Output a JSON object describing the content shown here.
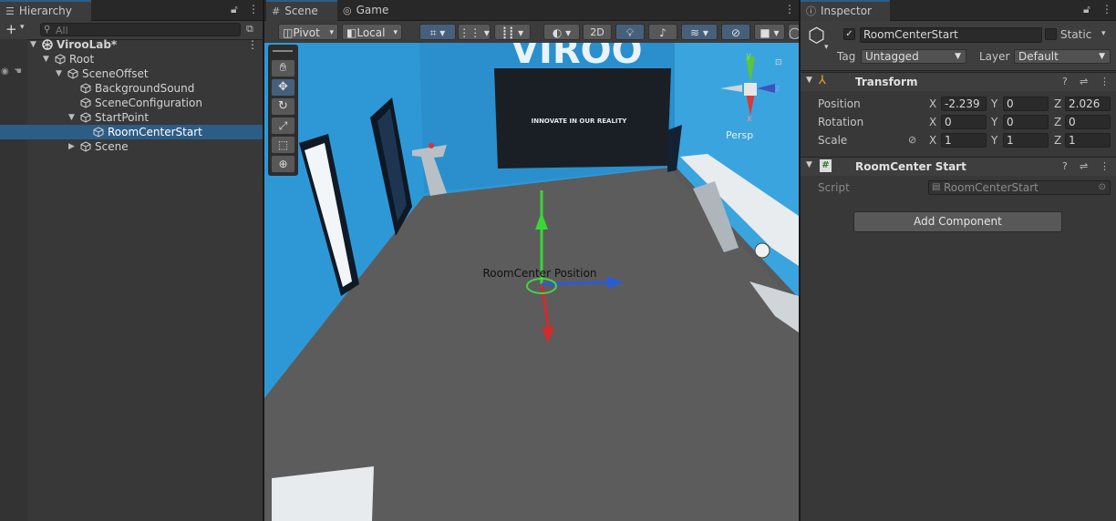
{
  "hierarchy": {
    "tab_title": "Hierarchy",
    "search_placeholder": "All",
    "rows": [
      {
        "label": "VirooLab*",
        "depth": 0,
        "expanded": true,
        "kind": "scene"
      },
      {
        "label": "Root",
        "depth": 1,
        "expanded": true,
        "kind": "object"
      },
      {
        "label": "SceneOffset",
        "depth": 2,
        "expanded": true,
        "kind": "object"
      },
      {
        "label": "BackgroundSound",
        "depth": 3,
        "expanded": null,
        "kind": "object"
      },
      {
        "label": "SceneConfiguration",
        "depth": 3,
        "expanded": null,
        "kind": "object"
      },
      {
        "label": "StartPoint",
        "depth": 3,
        "expanded": true,
        "kind": "object"
      },
      {
        "label": "RoomCenterStart",
        "depth": 4,
        "expanded": null,
        "kind": "object",
        "selected": true
      },
      {
        "label": "Scene",
        "depth": 3,
        "expanded": false,
        "kind": "object"
      }
    ]
  },
  "scene_view": {
    "tabs": [
      {
        "label": "Scene",
        "icon": "grid-icon",
        "active": true
      },
      {
        "label": "Game",
        "icon": "gamepad-icon",
        "active": false
      }
    ],
    "toolbar": {
      "pivot_label": "Pivot",
      "local_label": "Local",
      "mode_2d_label": "2D"
    },
    "tools": [
      "hand-tool",
      "move-tool",
      "rotate-tool",
      "scale-tool",
      "rect-tool",
      "transform-tool"
    ],
    "wall_sign": "VIROO",
    "screen_text": "INNOVATE IN OUR REALITY",
    "gizmo_label": "RoomCenter Position",
    "orientation": {
      "persp_label": "Persp",
      "x": "x",
      "y": "y",
      "z": "z"
    }
  },
  "inspector": {
    "tab_title": "Inspector",
    "object_name": "RoomCenterStart",
    "active": true,
    "static_label": "Static",
    "tag_label": "Tag",
    "tag_value": "Untagged",
    "layer_label": "Layer",
    "layer_value": "Default",
    "transform": {
      "title": "Transform",
      "position_label": "Position",
      "rotation_label": "Rotation",
      "scale_label": "Scale",
      "position": {
        "x": "-2.239",
        "y": "0",
        "z": "2.026"
      },
      "rotation": {
        "x": "0",
        "y": "0",
        "z": "0"
      },
      "scale": {
        "x": "1",
        "y": "1",
        "z": "1"
      },
      "axis_x": "X",
      "axis_y": "Y",
      "axis_z": "Z"
    },
    "script_component": {
      "title": "RoomCenter Start",
      "script_label": "Script",
      "script_value": "RoomCenterStart"
    },
    "add_component_label": "Add Component"
  },
  "colors": {
    "selection": "#2c5d87",
    "wall": "#2e9ad6",
    "floor": "#5d5d5d",
    "gizmo_y": "#35d935",
    "gizmo_x": "#d42a2a",
    "gizmo_z": "#2a5bd7"
  }
}
